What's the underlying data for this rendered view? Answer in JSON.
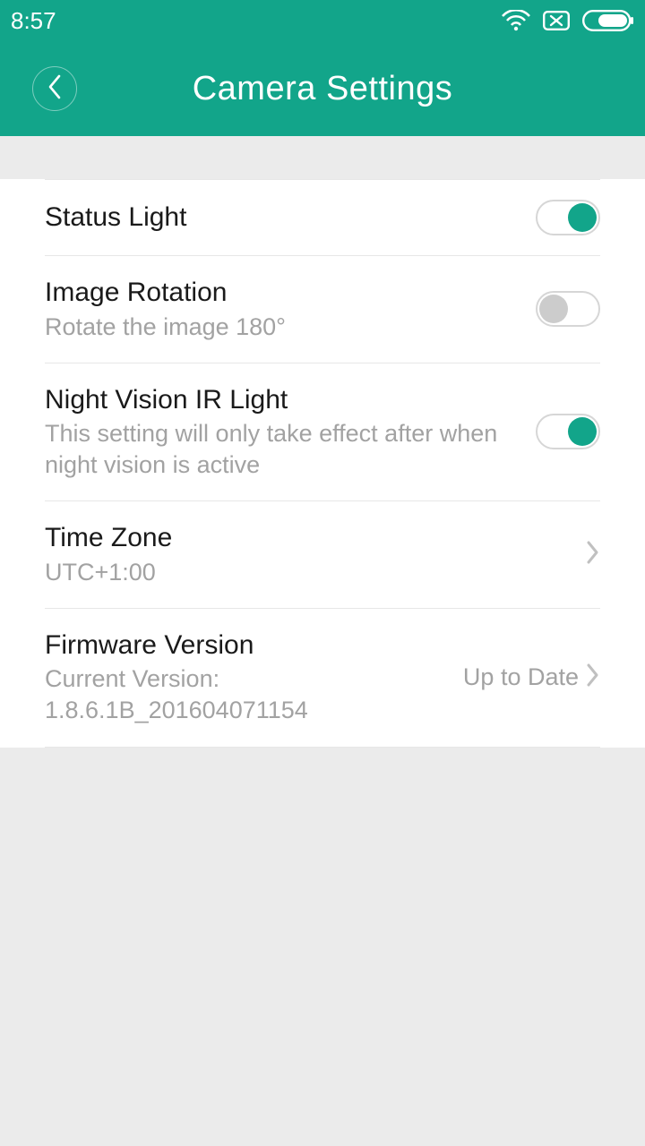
{
  "statusbar": {
    "time": "8:57"
  },
  "header": {
    "title": "Camera Settings"
  },
  "settings": {
    "status_light": {
      "title": "Status Light",
      "on": true
    },
    "image_rotation": {
      "title": "Image Rotation",
      "subtitle": "Rotate the image 180°",
      "on": false
    },
    "night_vision": {
      "title": "Night Vision IR Light",
      "subtitle": "This setting will only take effect after when night vision is active",
      "on": true
    },
    "time_zone": {
      "title": "Time Zone",
      "value": "UTC+1:00"
    },
    "firmware": {
      "title": "Firmware Version",
      "subtitle": "Current Version: 1.8.6.1B_201604071154",
      "status": "Up to Date"
    }
  }
}
